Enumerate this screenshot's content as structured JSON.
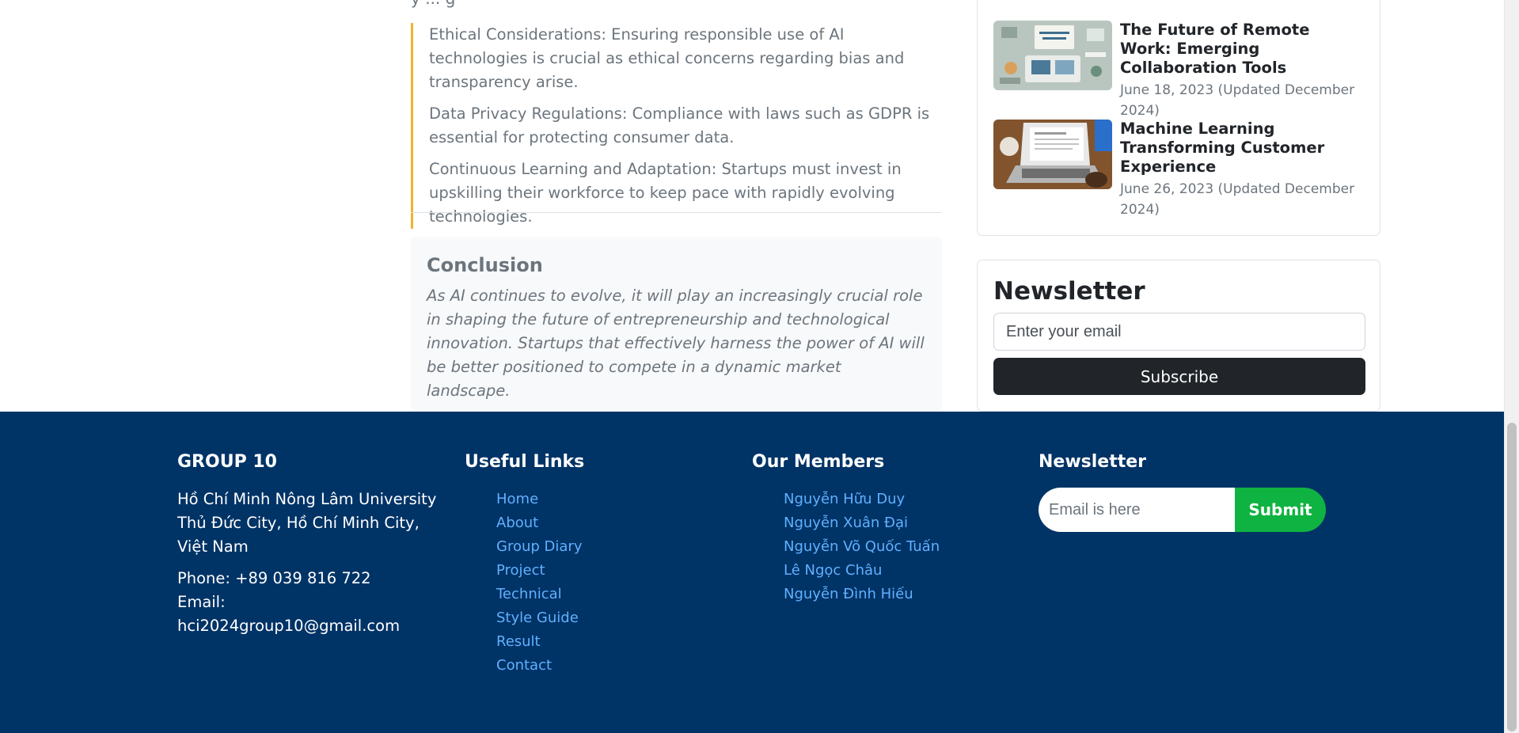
{
  "article": {
    "cut_text": "y ... g",
    "points": [
      "Ethical Considerations: Ensuring responsible use of AI technologies is crucial as ethical concerns regarding bias and transparency arise.",
      "Data Privacy Regulations: Compliance with laws such as GDPR is essential for protecting consumer data.",
      "Continuous Learning and Adaptation: Startups must invest in upskilling their workforce to keep pace with rapidly evolving technologies."
    ],
    "conclusion": {
      "title": "Conclusion",
      "text": "As AI continues to evolve, it will play an increasingly crucial role in shaping the future of entrepreneurship and technological innovation. Startups that effectively harness the power of AI will be better positioned to compete in a dynamic market landscape."
    }
  },
  "sidebar": {
    "posts": [
      {
        "title": "The Future of Remote Work: Emerging Collaboration Tools",
        "date": "June 18, 2023 (Updated December 2024)"
      },
      {
        "title": "Machine Learning Transforming Customer Experience",
        "date": "June 26, 2023 (Updated December 2024)"
      }
    ],
    "newsletter": {
      "title": "Newsletter",
      "placeholder": "Enter your email",
      "button": "Subscribe"
    }
  },
  "footer": {
    "group": {
      "title": "GROUP 10",
      "address": "Hồ Chí Minh Nông Lâm University Thủ Đức City, Hồ Chí Minh City, Việt Nam",
      "phone": "Phone: +89 039 816 722",
      "email": "Email: hci2024group10@gmail.com"
    },
    "useful_links": {
      "title": "Useful Links",
      "items": [
        "Home",
        "About",
        "Group Diary",
        "Project",
        "Technical",
        "Style Guide",
        "Result",
        "Contact"
      ]
    },
    "members": {
      "title": "Our Members",
      "items": [
        "Nguyễn Hữu Duy",
        "Nguyễn Xuân Đại",
        "Nguyễn Võ Quốc Tuấn",
        "Lê Ngọc Châu",
        "Nguyễn Đình Hiếu"
      ]
    },
    "newsletter": {
      "title": "Newsletter",
      "placeholder": "Email is here",
      "button": "Submit"
    }
  },
  "colors": {
    "footer_bg": "#003366",
    "link": "#61b0ff",
    "submit": "#0fb341",
    "quote_border": "#f0b429",
    "subscribe": "#212529"
  }
}
